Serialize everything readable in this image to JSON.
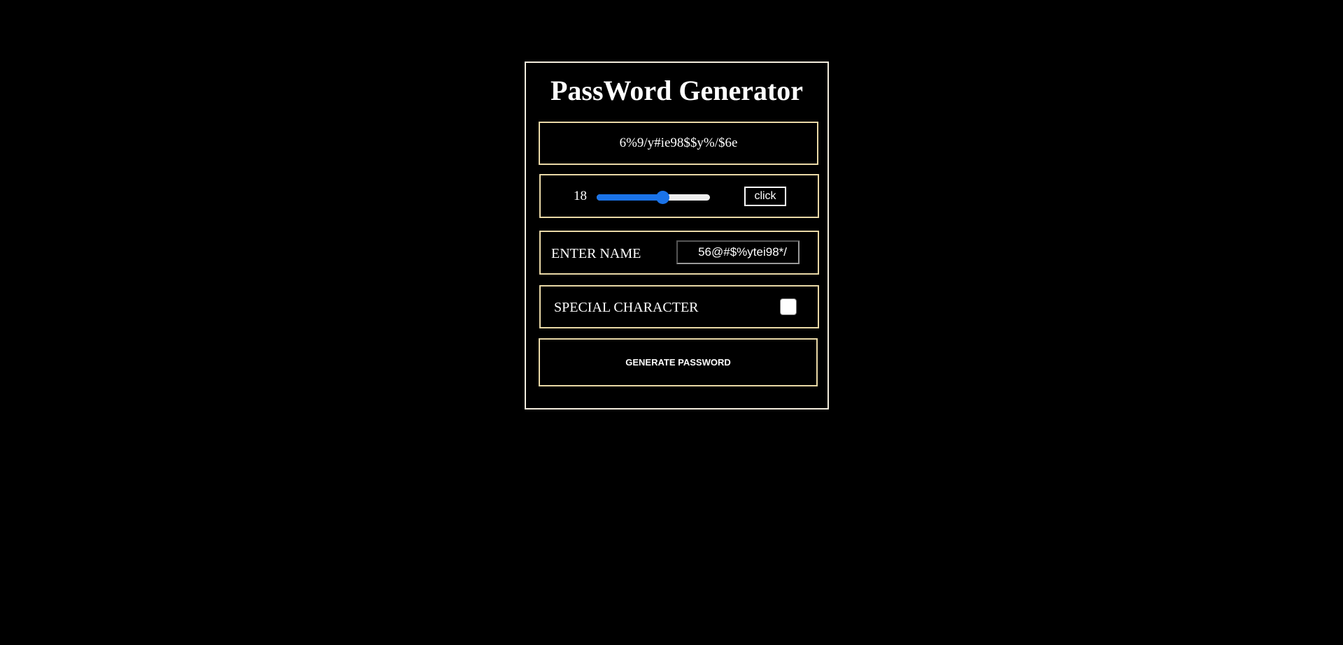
{
  "app": {
    "title": "PassWord Generator"
  },
  "password": {
    "value": "6%9/y#ie98$$y%/$6e"
  },
  "length": {
    "value": "18",
    "slider_fraction": 0.58,
    "button_label": "click"
  },
  "name": {
    "label": "ENTER NAME",
    "input_value": "56@#$%ytei98*/"
  },
  "special": {
    "label": "SPECIAL CHARACTER",
    "checked": false
  },
  "generate": {
    "label": "GENERATE PASSWORD"
  },
  "colors": {
    "background": "#000000",
    "card_border": "#f3ecdd",
    "box_border": "#e9d8a6",
    "slider_accent": "#1a73e8"
  }
}
